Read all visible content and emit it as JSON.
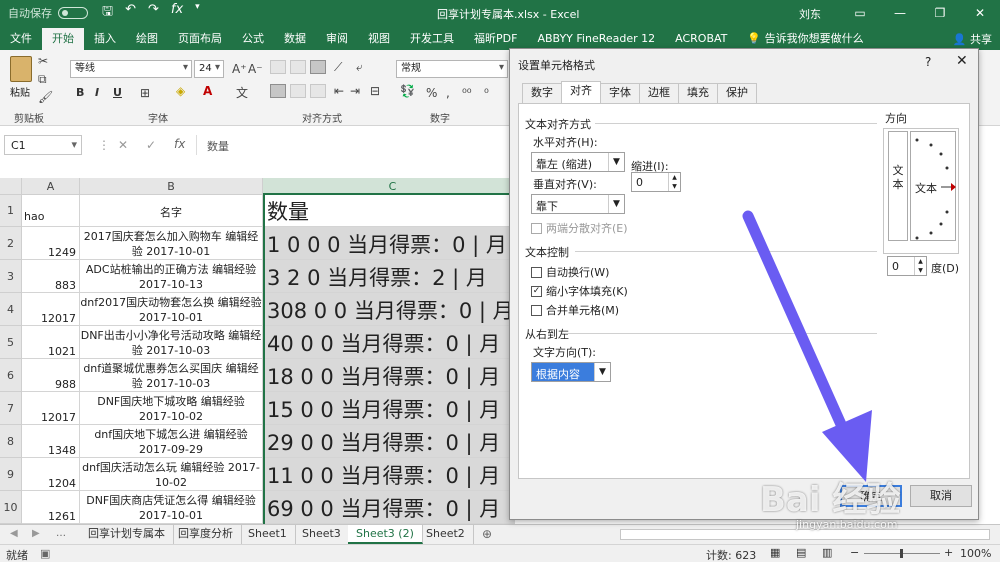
{
  "titlebar": {
    "autosave": "自动保存",
    "autosave_state": "关",
    "doc_title": "回享计划专属本.xlsx  -  Excel",
    "user": "刘东",
    "icons": [
      "save-icon",
      "undo-icon",
      "redo-icon",
      "fx-icon",
      "customize-icon"
    ]
  },
  "ribbon_tabs": [
    "文件",
    "开始",
    "插入",
    "绘图",
    "页面布局",
    "公式",
    "数据",
    "审阅",
    "视图",
    "开发工具",
    "福昕PDF",
    "ABBYY FineReader 12",
    "ACROBAT",
    "告诉我你想要做什么"
  ],
  "active_tab_index": 1,
  "share_label": "共享",
  "ribbon": {
    "paste": "粘贴",
    "clipboard": "剪贴板",
    "font_group": "字体",
    "align_group": "对齐方式",
    "number_group": "数字",
    "font_name": "等线",
    "font_size": "24",
    "number_format": "常规",
    "bold": "B",
    "italic": "I",
    "underline": "U",
    "percent": "%"
  },
  "formula_bar": {
    "name_box": "C1",
    "content": "数量"
  },
  "sheet": {
    "columns": [
      "A",
      "B",
      "C"
    ],
    "header_row": {
      "num": "1",
      "a": "hao",
      "b": "名字",
      "c": "数量"
    },
    "rows": [
      {
        "num": "2",
        "a": "1249",
        "b": "2017国庆套怎么加入购物车 编辑经验 2017-10-01",
        "c": "1 0 0 0 当月得票：0 | 月"
      },
      {
        "num": "3",
        "a": "883",
        "b": "ADC站桩输出的正确方法 编辑经验 2017-10-13",
        "c": "3 2 0 当月得票：2 | 月"
      },
      {
        "num": "4",
        "a": "12017",
        "b": "dnf2017国庆动物套怎么换 编辑经验 2017-10-01",
        "c": "308 0 0 当月得票：0 | 月"
      },
      {
        "num": "5",
        "a": "1021",
        "b": "DNF出击小小净化号活动攻略 编辑经验 2017-10-03",
        "c": "40 0 0 当月得票：0 | 月"
      },
      {
        "num": "6",
        "a": "988",
        "b": "dnf道聚城优惠券怎么买国庆 编辑经验 2017-10-03",
        "c": "18 0 0 当月得票：0 | 月"
      },
      {
        "num": "7",
        "a": "12017",
        "b": "DNF国庆地下城攻略 编辑经验 2017-10-02",
        "c": "15 0 0 当月得票：0 | 月"
      },
      {
        "num": "8",
        "a": "1348",
        "b": "dnf国庆地下城怎么进 编辑经验 2017-09-29",
        "c": "29 0 0 当月得票：0 | 月"
      },
      {
        "num": "9",
        "a": "1204",
        "b": "dnf国庆活动怎么玩 编辑经验 2017-10-02",
        "c": "11 0 0 当月得票：0 | 月"
      },
      {
        "num": "10",
        "a": "1261",
        "b": "DNF国庆商店凭证怎么得 编辑经验 2017-10-01",
        "c": "69 0 0 当月得票：0 | 月"
      }
    ]
  },
  "sheet_tabs": [
    "回享计划专属本",
    "回享度分析",
    "Sheet1",
    "Sheet3",
    "Sheet3 (2)",
    "Sheet2"
  ],
  "active_sheet_index": 4,
  "status": {
    "ready": "就绪",
    "count": "计数: 623",
    "zoom": "100%"
  },
  "dialog": {
    "title": "设置单元格格式",
    "help": "?",
    "close": "✕",
    "tabs": [
      "数字",
      "对齐",
      "字体",
      "边框",
      "填充",
      "保护"
    ],
    "active_tab_index": 1,
    "text_align_section": "文本对齐方式",
    "h_align_label": "水平对齐(H):",
    "h_align_value": "靠左 (缩进)",
    "indent_label": "缩进(I):",
    "indent_value": "0",
    "v_align_label": "垂直对齐(V):",
    "v_align_value": "靠下",
    "justify_distributed": "两端分散对齐(E)",
    "text_control_section": "文本控制",
    "wrap_text": "自动换行(W)",
    "shrink_to_fit": "缩小字体填充(K)",
    "merge_cells": "合并单元格(M)",
    "shrink_checked": true,
    "rtl_section": "从右到左",
    "text_direction_label": "文字方向(T):",
    "text_direction_value": "根据内容",
    "orientation_section": "方向",
    "vertical_text": "文本",
    "dial_text": "文本",
    "degree_value": "0",
    "degree_label": "度(D)",
    "ok": "确定",
    "cancel": "取消"
  },
  "watermark": {
    "brand": "Bai 经验",
    "url": "jingyan.baidu.com"
  },
  "colors": {
    "excel_green": "#217346",
    "arrow": "#6a5cf2",
    "cell_fill": "#d9d9d9"
  }
}
